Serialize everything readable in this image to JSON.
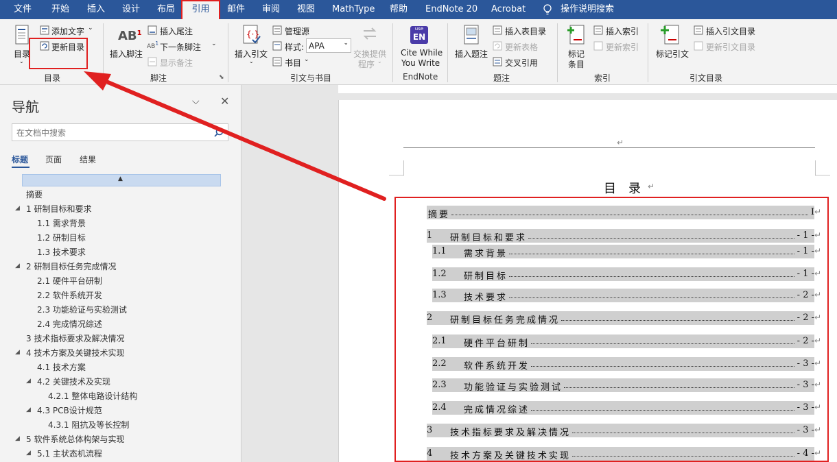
{
  "menubar": {
    "tabs": [
      "文件",
      "开始",
      "插入",
      "设计",
      "布局",
      "引用",
      "邮件",
      "审阅",
      "视图",
      "MathType",
      "帮助",
      "EndNote 20",
      "Acrobat"
    ],
    "active_tab": "引用",
    "tell_me": "操作说明搜索"
  },
  "ribbon": {
    "toc_group": {
      "toc": "目录",
      "add_text": "添加文字",
      "update_toc": "更新目录",
      "label": "目录"
    },
    "footnote_group": {
      "insert_footnote": "插入脚注",
      "insert_endnote": "插入尾注",
      "next_footnote": "下一条脚注",
      "show_notes": "显示备注",
      "label": "脚注"
    },
    "citation_group": {
      "insert_citation": "插入引文",
      "manage_sources": "管理源",
      "style_label": "样式:",
      "style_value": "APA",
      "bibliography": "书目",
      "cross_provider": "交换提供",
      "cross_provider2": "程序",
      "label": "引文与书目"
    },
    "endnote_group": {
      "cite_while": "Cite While",
      "you_write": "You Write",
      "label": "EndNote",
      "badge": "EN",
      "badge_top": "use"
    },
    "caption_group": {
      "insert_caption": "插入题注",
      "insert_tof": "插入表目录",
      "update_table": "更新表格",
      "cross_ref": "交叉引用",
      "label": "题注"
    },
    "index_group": {
      "mark_entry": "标记",
      "mark_entry2": "条目",
      "insert_index": "插入索引",
      "update_index": "更新索引",
      "label": "索引"
    },
    "toa_group": {
      "mark_citation": "标记引文",
      "insert_toa": "插入引文目录",
      "update_toa": "更新引文目录",
      "label": "引文目录"
    }
  },
  "nav": {
    "title": "导航",
    "search_placeholder": "在文档中搜索",
    "tabs": [
      "标题",
      "页面",
      "结果"
    ],
    "items": [
      "摘要",
      "1 研制目标和要求",
      "1.1 需求背景",
      "1.2 研制目标",
      "1.3 技术要求",
      "2 研制目标任务完成情况",
      "2.1 硬件平台研制",
      "2.2 软件系统开发",
      "2.3 功能验证与实验测试",
      "2.4 完成情况综述",
      "3 技术指标要求及解决情况",
      "4 技术方案及关键技术实现",
      "4.1 技术方案",
      "4.2 关键技术及实现",
      "4.2.1 整体电路设计结构",
      "4.3 PCB设计规范",
      "4.3.1 阻抗及等长控制",
      "5 软件系统总体构架与实现",
      "5.1 主状态机流程"
    ]
  },
  "document": {
    "toc_title": "目　录",
    "toc": [
      {
        "num": "",
        "text": "摘要",
        "page": "I"
      },
      {
        "num": "1",
        "text": "研制目标和要求",
        "page": "- 1 -"
      },
      {
        "num": "1.1",
        "text": "需求背景",
        "page": "- 1 -"
      },
      {
        "num": "1.2",
        "text": "研制目标",
        "page": "- 1 -"
      },
      {
        "num": "1.3",
        "text": "技术要求",
        "page": "- 2 -"
      },
      {
        "num": "2",
        "text": "研制目标任务完成情况",
        "page": "- 2 -"
      },
      {
        "num": "2.1",
        "text": "硬件平台研制",
        "page": "- 2 -"
      },
      {
        "num": "2.2",
        "text": "软件系统开发",
        "page": "- 3 -"
      },
      {
        "num": "2.3",
        "text": "功能验证与实验测试",
        "page": "- 3 -"
      },
      {
        "num": "2.4",
        "text": "完成情况综述",
        "page": "- 3 -"
      },
      {
        "num": "3",
        "text": "技术指标要求及解决情况",
        "page": "- 3 -"
      },
      {
        "num": "4",
        "text": "技术方案及关键技术实现",
        "page": "- 4 -"
      }
    ]
  },
  "colors": {
    "accent": "#2b579a",
    "highlight": "#e02020",
    "toc_shade": "#cfcfcf"
  }
}
